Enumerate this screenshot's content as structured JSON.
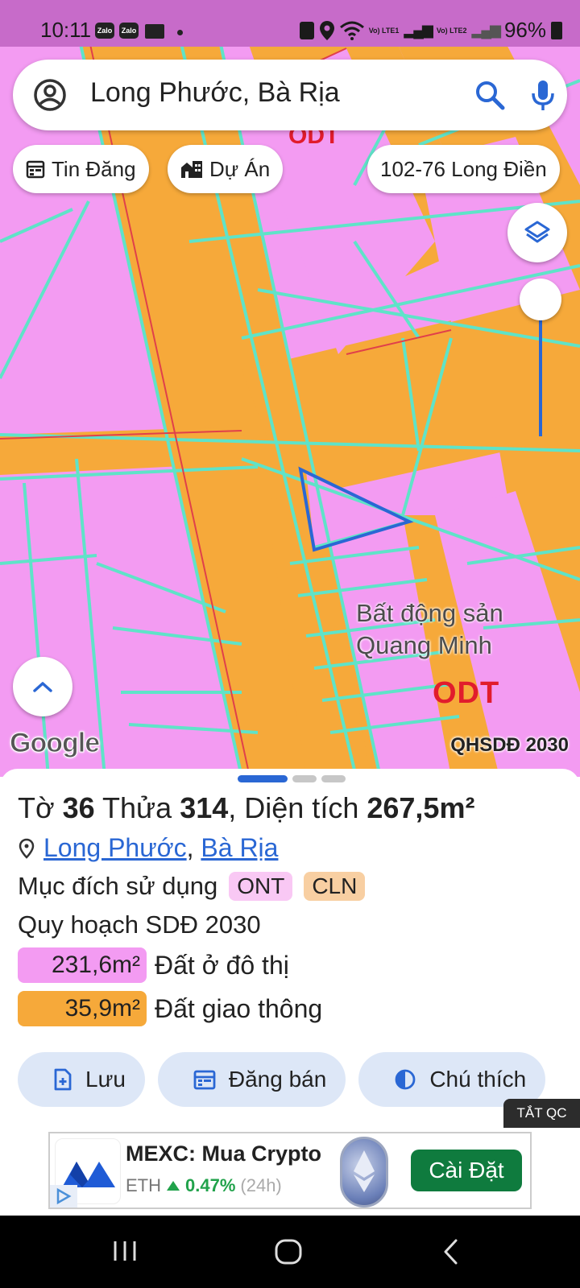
{
  "status_bar": {
    "time": "10:11",
    "app_icons": [
      "Zalo",
      "Zalo"
    ],
    "network": "Vo) LTE1",
    "network2": "Vo) LTE2",
    "battery": "96%"
  },
  "search": {
    "query": "Long Phước, Bà Rịa",
    "account_icon": "account-circle-icon",
    "search_icon": "search-icon",
    "mic_icon": "mic-icon"
  },
  "chips": [
    {
      "label": "Tin Đăng",
      "icon": "calendar-icon"
    },
    {
      "label": "Dự Án",
      "icon": "buildings-icon"
    },
    {
      "label": "102-76 Long Điền",
      "icon": ""
    }
  ],
  "map": {
    "poi_label_1": "Bất động sản",
    "poi_label_2": "Quang Minh",
    "zone_label": "ODT",
    "zone_label_top": "ODT",
    "google_logo": "Google",
    "plan_badge": "QHSDĐ 2030",
    "colors": {
      "residential": "#f39bf2",
      "road": "#f6a93a",
      "parcel_lines": "#5fe3c8",
      "selection": "#2a67d4"
    }
  },
  "sheet": {
    "to_label": "Tờ",
    "to_value": "36",
    "thua_label": "Thửa",
    "thua_value": "314",
    "area_label": ", Diện tích",
    "area_value": "267,5m²",
    "location_1": "Long Phước",
    "location_sep": ",",
    "location_2": "Bà Rịa",
    "purpose_label": "Mục đích sử dụng",
    "purpose_tags": [
      {
        "label": "ONT",
        "color": "#f9c8f4"
      },
      {
        "label": "CLN",
        "color": "#f8cfa2"
      }
    ],
    "plan_title": "Quy hoạch SDĐ 2030",
    "areas": [
      {
        "value": "231,6m²",
        "label": "Đất ở đô thị",
        "color": "#f39bf2"
      },
      {
        "value": "35,9m²",
        "label": "Đất giao thông",
        "color": "#f6a93a"
      }
    ],
    "actions": [
      {
        "label": "Lưu",
        "icon": "add-file-icon"
      },
      {
        "label": "Đăng bán",
        "icon": "calendar-icon"
      },
      {
        "label": "Chú thích",
        "icon": "contrast-icon"
      }
    ],
    "hide_ads": "TẮT QC"
  },
  "ad": {
    "title": "MEXC: Mua Crypto",
    "ticker": "ETH",
    "change": "0.47%",
    "period": "(24h)",
    "button": "Cài Đặt"
  }
}
